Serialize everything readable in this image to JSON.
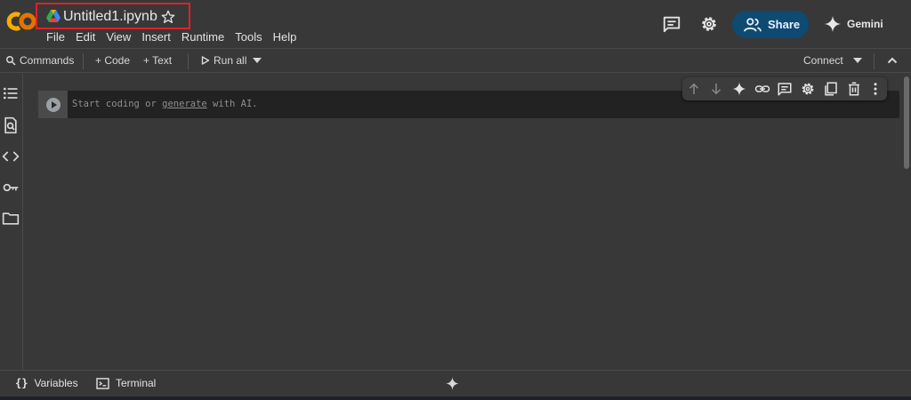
{
  "app": {
    "logo_text": "CO",
    "notebook_title": "Untitled1.ipynb"
  },
  "menu": [
    "File",
    "Edit",
    "View",
    "Insert",
    "Runtime",
    "Tools",
    "Help"
  ],
  "header_actions": {
    "share_label": "Share",
    "gemini_label": "Gemini"
  },
  "toolbar": {
    "commands_label": "Commands",
    "code_label": "+ Code",
    "text_label": "+ Text",
    "run_all_label": "Run all",
    "connect_label": "Connect"
  },
  "cell": {
    "placeholder_start": "Start coding or ",
    "placeholder_link": "generate",
    "placeholder_end": " with AI."
  },
  "bottom": {
    "variables_label": "Variables",
    "terminal_label": "Terminal"
  },
  "colors": {
    "background": "#383838",
    "share_button": "#0f4a73",
    "highlight_box": "#e0202a",
    "logo_orange": "#f9ab00",
    "logo_dark_orange": "#e37400"
  }
}
